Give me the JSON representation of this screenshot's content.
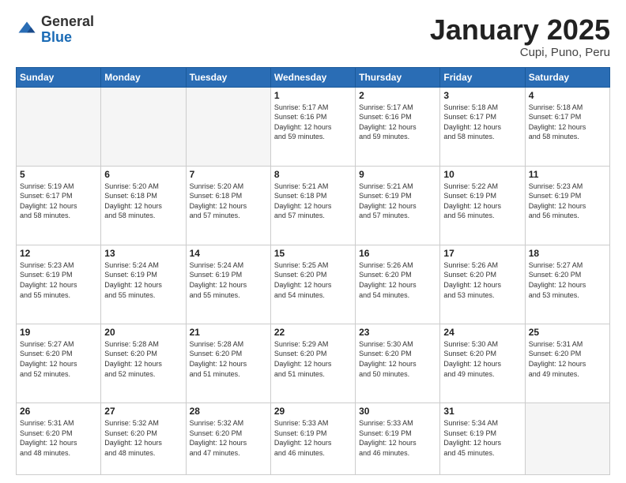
{
  "logo": {
    "general": "General",
    "blue": "Blue"
  },
  "title": {
    "month": "January 2025",
    "location": "Cupi, Puno, Peru"
  },
  "weekdays": [
    "Sunday",
    "Monday",
    "Tuesday",
    "Wednesday",
    "Thursday",
    "Friday",
    "Saturday"
  ],
  "weeks": [
    [
      {
        "day": "",
        "info": ""
      },
      {
        "day": "",
        "info": ""
      },
      {
        "day": "",
        "info": ""
      },
      {
        "day": "1",
        "info": "Sunrise: 5:17 AM\nSunset: 6:16 PM\nDaylight: 12 hours\nand 59 minutes."
      },
      {
        "day": "2",
        "info": "Sunrise: 5:17 AM\nSunset: 6:16 PM\nDaylight: 12 hours\nand 59 minutes."
      },
      {
        "day": "3",
        "info": "Sunrise: 5:18 AM\nSunset: 6:17 PM\nDaylight: 12 hours\nand 58 minutes."
      },
      {
        "day": "4",
        "info": "Sunrise: 5:18 AM\nSunset: 6:17 PM\nDaylight: 12 hours\nand 58 minutes."
      }
    ],
    [
      {
        "day": "5",
        "info": "Sunrise: 5:19 AM\nSunset: 6:17 PM\nDaylight: 12 hours\nand 58 minutes."
      },
      {
        "day": "6",
        "info": "Sunrise: 5:20 AM\nSunset: 6:18 PM\nDaylight: 12 hours\nand 58 minutes."
      },
      {
        "day": "7",
        "info": "Sunrise: 5:20 AM\nSunset: 6:18 PM\nDaylight: 12 hours\nand 57 minutes."
      },
      {
        "day": "8",
        "info": "Sunrise: 5:21 AM\nSunset: 6:18 PM\nDaylight: 12 hours\nand 57 minutes."
      },
      {
        "day": "9",
        "info": "Sunrise: 5:21 AM\nSunset: 6:19 PM\nDaylight: 12 hours\nand 57 minutes."
      },
      {
        "day": "10",
        "info": "Sunrise: 5:22 AM\nSunset: 6:19 PM\nDaylight: 12 hours\nand 56 minutes."
      },
      {
        "day": "11",
        "info": "Sunrise: 5:23 AM\nSunset: 6:19 PM\nDaylight: 12 hours\nand 56 minutes."
      }
    ],
    [
      {
        "day": "12",
        "info": "Sunrise: 5:23 AM\nSunset: 6:19 PM\nDaylight: 12 hours\nand 55 minutes."
      },
      {
        "day": "13",
        "info": "Sunrise: 5:24 AM\nSunset: 6:19 PM\nDaylight: 12 hours\nand 55 minutes."
      },
      {
        "day": "14",
        "info": "Sunrise: 5:24 AM\nSunset: 6:19 PM\nDaylight: 12 hours\nand 55 minutes."
      },
      {
        "day": "15",
        "info": "Sunrise: 5:25 AM\nSunset: 6:20 PM\nDaylight: 12 hours\nand 54 minutes."
      },
      {
        "day": "16",
        "info": "Sunrise: 5:26 AM\nSunset: 6:20 PM\nDaylight: 12 hours\nand 54 minutes."
      },
      {
        "day": "17",
        "info": "Sunrise: 5:26 AM\nSunset: 6:20 PM\nDaylight: 12 hours\nand 53 minutes."
      },
      {
        "day": "18",
        "info": "Sunrise: 5:27 AM\nSunset: 6:20 PM\nDaylight: 12 hours\nand 53 minutes."
      }
    ],
    [
      {
        "day": "19",
        "info": "Sunrise: 5:27 AM\nSunset: 6:20 PM\nDaylight: 12 hours\nand 52 minutes."
      },
      {
        "day": "20",
        "info": "Sunrise: 5:28 AM\nSunset: 6:20 PM\nDaylight: 12 hours\nand 52 minutes."
      },
      {
        "day": "21",
        "info": "Sunrise: 5:28 AM\nSunset: 6:20 PM\nDaylight: 12 hours\nand 51 minutes."
      },
      {
        "day": "22",
        "info": "Sunrise: 5:29 AM\nSunset: 6:20 PM\nDaylight: 12 hours\nand 51 minutes."
      },
      {
        "day": "23",
        "info": "Sunrise: 5:30 AM\nSunset: 6:20 PM\nDaylight: 12 hours\nand 50 minutes."
      },
      {
        "day": "24",
        "info": "Sunrise: 5:30 AM\nSunset: 6:20 PM\nDaylight: 12 hours\nand 49 minutes."
      },
      {
        "day": "25",
        "info": "Sunrise: 5:31 AM\nSunset: 6:20 PM\nDaylight: 12 hours\nand 49 minutes."
      }
    ],
    [
      {
        "day": "26",
        "info": "Sunrise: 5:31 AM\nSunset: 6:20 PM\nDaylight: 12 hours\nand 48 minutes."
      },
      {
        "day": "27",
        "info": "Sunrise: 5:32 AM\nSunset: 6:20 PM\nDaylight: 12 hours\nand 48 minutes."
      },
      {
        "day": "28",
        "info": "Sunrise: 5:32 AM\nSunset: 6:20 PM\nDaylight: 12 hours\nand 47 minutes."
      },
      {
        "day": "29",
        "info": "Sunrise: 5:33 AM\nSunset: 6:19 PM\nDaylight: 12 hours\nand 46 minutes."
      },
      {
        "day": "30",
        "info": "Sunrise: 5:33 AM\nSunset: 6:19 PM\nDaylight: 12 hours\nand 46 minutes."
      },
      {
        "day": "31",
        "info": "Sunrise: 5:34 AM\nSunset: 6:19 PM\nDaylight: 12 hours\nand 45 minutes."
      },
      {
        "day": "",
        "info": ""
      }
    ]
  ]
}
